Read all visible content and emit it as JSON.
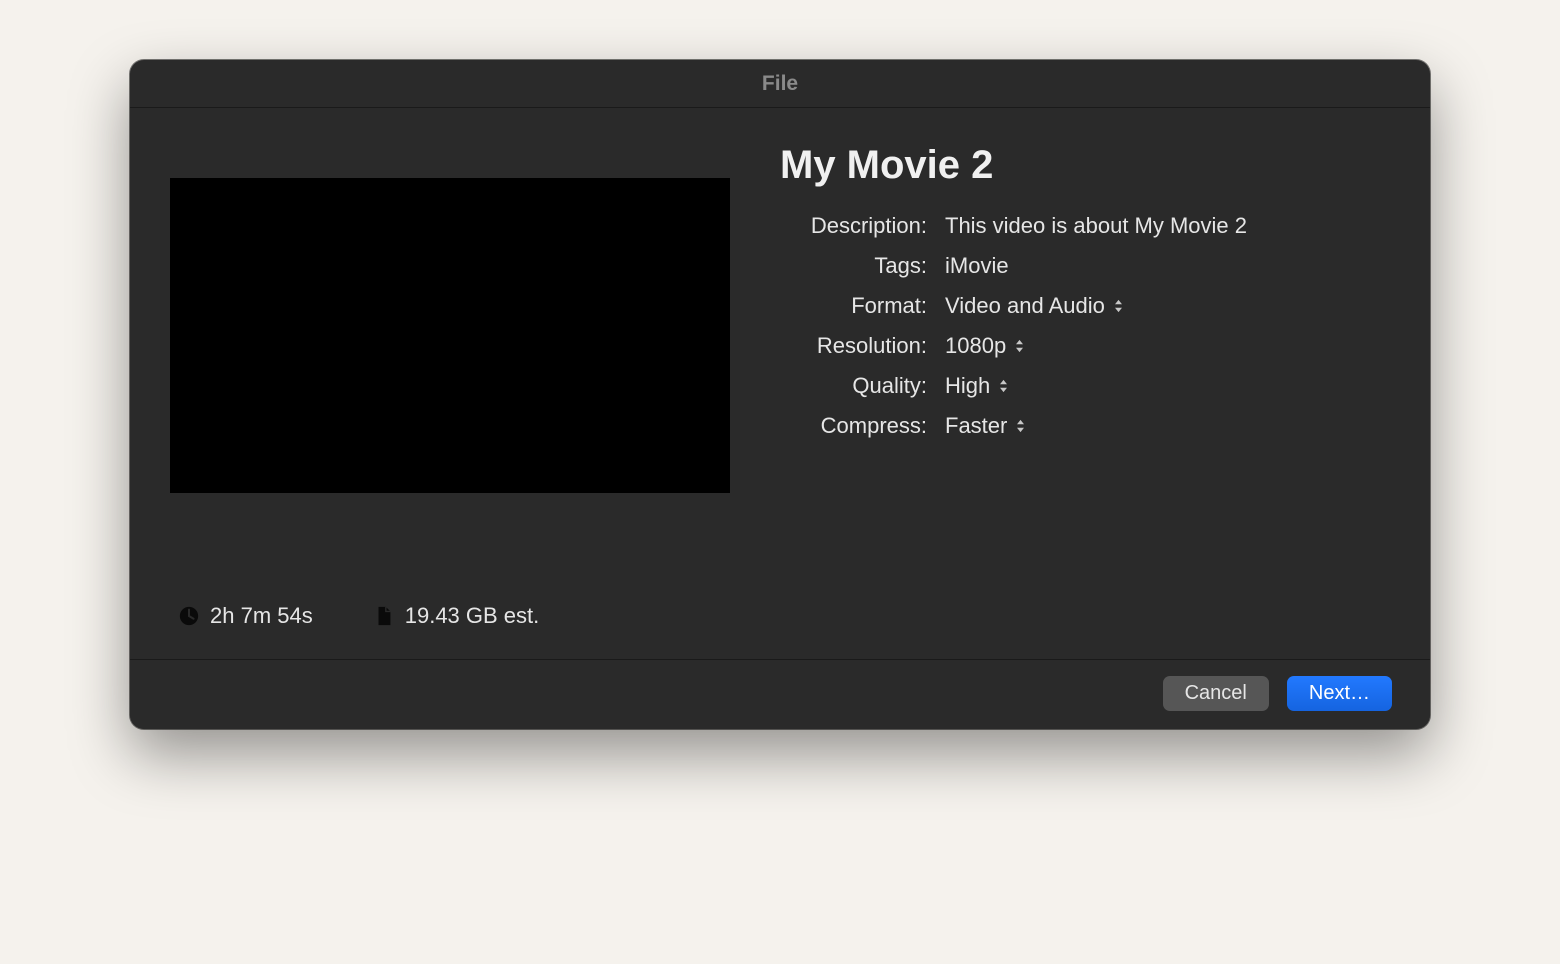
{
  "window": {
    "title": "File"
  },
  "movie": {
    "title": "My Movie 2"
  },
  "fields": {
    "description": {
      "label": "Description:",
      "value": "This video is about My Movie 2"
    },
    "tags": {
      "label": "Tags:",
      "value": "iMovie"
    },
    "format": {
      "label": "Format:",
      "value": "Video and Audio"
    },
    "resolution": {
      "label": "Resolution:",
      "value": "1080p"
    },
    "quality": {
      "label": "Quality:",
      "value": "High"
    },
    "compress": {
      "label": "Compress:",
      "value": "Faster"
    }
  },
  "meta": {
    "duration": "2h 7m 54s",
    "size": "19.43 GB est."
  },
  "buttons": {
    "cancel": "Cancel",
    "next": "Next…"
  }
}
